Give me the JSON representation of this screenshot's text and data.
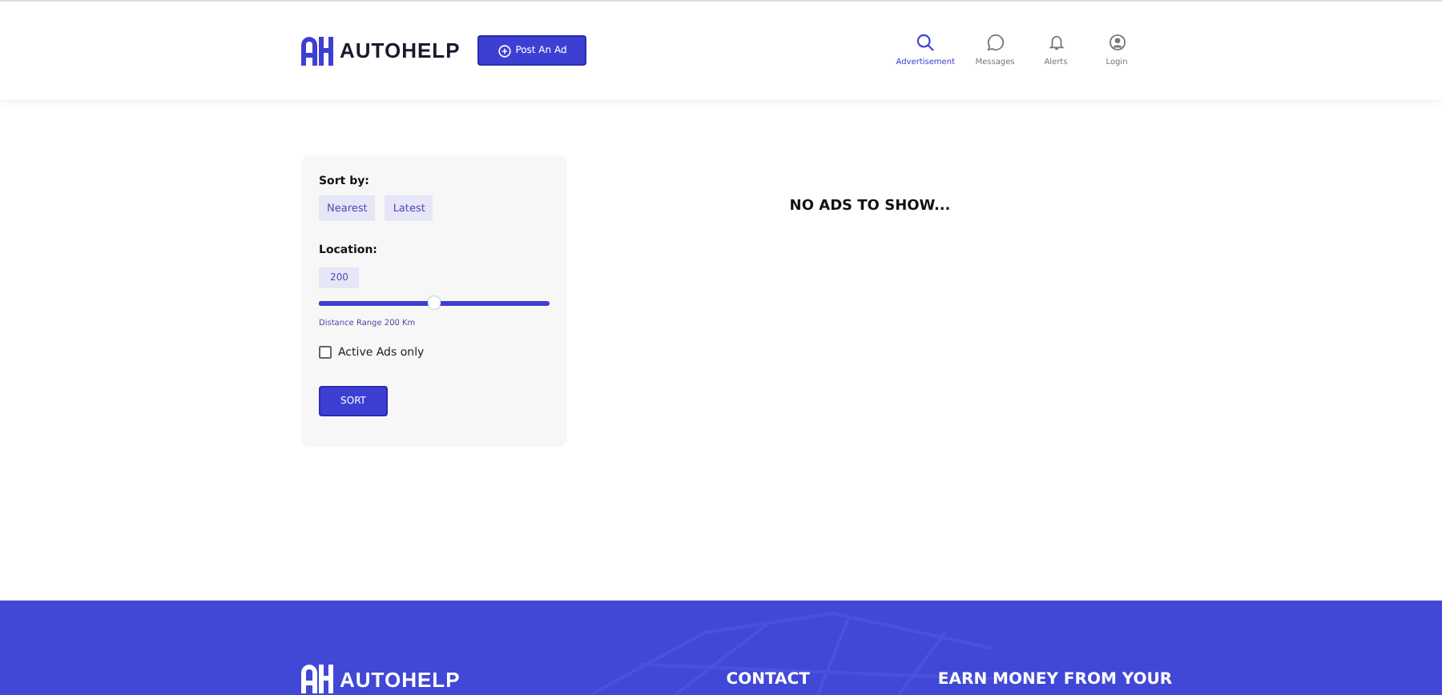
{
  "header": {
    "logo": "AUTOHELP",
    "post_button": "Post An Ad",
    "nav": [
      {
        "label": "Advertisement",
        "kind": "search",
        "selected": true
      },
      {
        "label": "Messages",
        "kind": "chat",
        "selected": false
      },
      {
        "label": "Alerts",
        "kind": "bell",
        "selected": false
      },
      {
        "label": "Login",
        "kind": "user",
        "selected": false
      }
    ]
  },
  "filters": {
    "sort_label": "Sort by:",
    "sort_options": [
      "Nearest",
      "Latest"
    ],
    "location_label": "Location:",
    "distance_value": "200",
    "distance_slider": {
      "level": 0.5
    },
    "range_text": "Distance Range 200 Km",
    "active_only": {
      "label": "Active Ads only",
      "checked": false
    },
    "sort_button": "SORT"
  },
  "empty_message": "NO ADS TO SHOW...",
  "footer": {
    "logo": "AUTOHELP",
    "headings": [
      "CONTACT",
      "EARN MONEY FROM YOUR"
    ]
  }
}
